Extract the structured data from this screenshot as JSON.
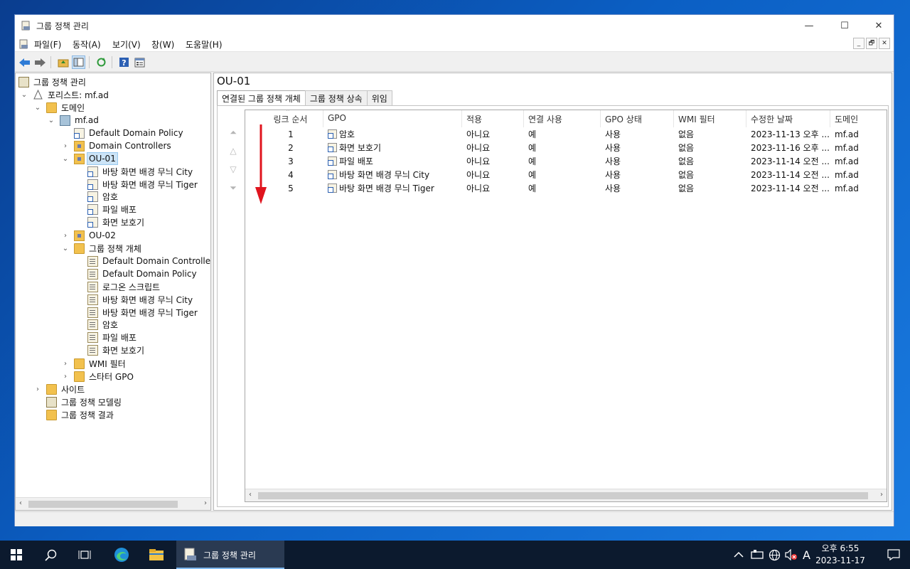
{
  "window": {
    "title": "그룹 정책 관리",
    "controls": {
      "minimize": "—",
      "maximize": "☐",
      "close": "✕"
    }
  },
  "menu": [
    "파일(F)",
    "동작(A)",
    "보기(V)",
    "창(W)",
    "도움말(H)"
  ],
  "mdi_controls": {
    "minimize": "_",
    "restore": "🗗",
    "close": "✕"
  },
  "toolbar": [
    "back-icon",
    "forward-icon",
    "up-folder-icon",
    "show-hide-tree-icon",
    "refresh-icon",
    "help-icon",
    "properties-icon"
  ],
  "tree": {
    "root": "그룹 정책 관리",
    "forest": "포리스트: mf.ad",
    "domains": "도메인",
    "domain": "mf.ad",
    "default_domain_policy": "Default Domain Policy",
    "domain_controllers": "Domain Controllers",
    "ou01": "OU-01",
    "ou01_links": [
      "바탕 화면 배경 무늬 City",
      "바탕 화면 배경 무늬 Tiger",
      "암호",
      "파일 배포",
      "화면 보호기"
    ],
    "ou02": "OU-02",
    "gpo_container": "그룹 정책 개체",
    "gpo_objects": [
      "Default Domain Controllers",
      "Default Domain Policy",
      "로그온 스크립트",
      "바탕 화면 배경 무늬 City",
      "바탕 화면 배경 무늬 Tiger",
      "암호",
      "파일 배포",
      "화면 보호기"
    ],
    "wmi_filters": "WMI 필터",
    "starter_gpo": "스타터 GPO",
    "sites": "사이트",
    "modeling": "그룹 정책 모델링",
    "results": "그룹 정책 결과"
  },
  "detail": {
    "title": "OU-01",
    "tabs": [
      "연결된 그룹 정책 개체",
      "그룹 정책 상속",
      "위임"
    ],
    "columns": [
      "링크 순서",
      "GPO",
      "적용",
      "연결 사용",
      "GPO 상태",
      "WMI 필터",
      "수정한 날짜",
      "도메인"
    ],
    "rows": [
      [
        "1",
        "암호",
        "아니요",
        "예",
        "사용",
        "없음",
        "2023-11-13 오후 ...",
        "mf.ad"
      ],
      [
        "2",
        "화면 보호기",
        "아니요",
        "예",
        "사용",
        "없음",
        "2023-11-16 오후 ...",
        "mf.ad"
      ],
      [
        "3",
        "파일 배포",
        "아니요",
        "예",
        "사용",
        "없음",
        "2023-11-14 오전 ...",
        "mf.ad"
      ],
      [
        "4",
        "바탕 화면 배경 무늬 City",
        "아니요",
        "예",
        "사용",
        "없음",
        "2023-11-14 오전 ...",
        "mf.ad"
      ],
      [
        "5",
        "바탕 화면 배경 무늬 Tiger",
        "아니요",
        "예",
        "사용",
        "없음",
        "2023-11-14 오전 ...",
        "mf.ad"
      ]
    ]
  },
  "taskbar": {
    "app_label": "그룹 정책 관리",
    "ime": "A",
    "time": "오후 6:55",
    "date": "2023-11-17"
  },
  "colors": {
    "annotation_arrow": "#e0141e",
    "selection": "#cce4f7"
  }
}
